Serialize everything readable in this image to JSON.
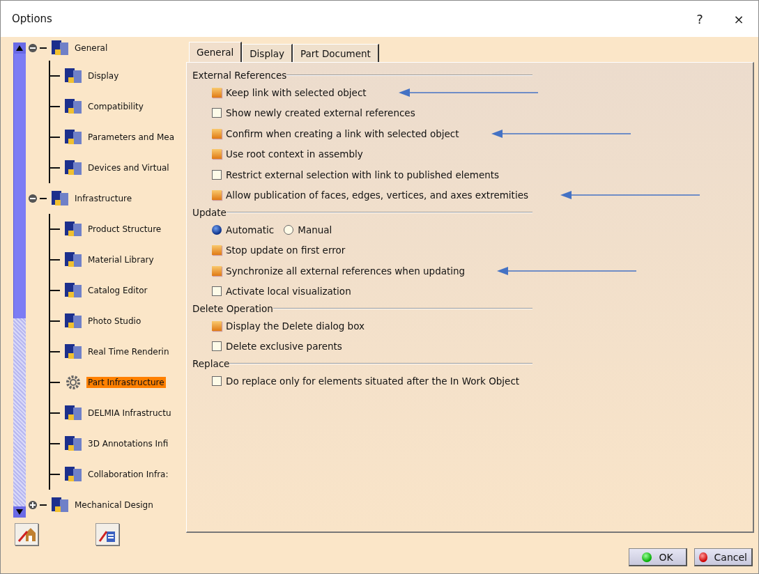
{
  "window": {
    "title": "Options",
    "help": "?",
    "close": "×"
  },
  "tree": [
    {
      "label": "General",
      "expanded": true,
      "selected": false,
      "children": [
        {
          "label": "Display",
          "selected": false
        },
        {
          "label": "Compatibility",
          "selected": false
        },
        {
          "label": "Parameters and Mea",
          "selected": false
        },
        {
          "label": "Devices and Virtual",
          "selected": false
        }
      ]
    },
    {
      "label": "Infrastructure",
      "expanded": true,
      "selected": false,
      "children": [
        {
          "label": "Product Structure",
          "selected": false
        },
        {
          "label": "Material Library",
          "selected": false
        },
        {
          "label": "Catalog Editor",
          "selected": false
        },
        {
          "label": "Photo Studio",
          "selected": false
        },
        {
          "label": "Real Time Renderin",
          "selected": false
        },
        {
          "label": "Part Infrastructure",
          "selected": true
        },
        {
          "label": "DELMIA Infrastructu",
          "selected": false
        },
        {
          "label": "3D Annotations Infi",
          "selected": false
        },
        {
          "label": "Collaboration Infra:",
          "selected": false
        }
      ]
    },
    {
      "label": "Mechanical Design",
      "expanded": false,
      "selected": false
    }
  ],
  "tabs": [
    {
      "label": "General",
      "selected": true
    },
    {
      "label": "Display",
      "selected": false
    },
    {
      "label": "Part Document",
      "selected": false
    }
  ],
  "sections": [
    {
      "title": "External References",
      "items": [
        {
          "kind": "checkbox",
          "label": "Keep link with selected object",
          "checked": true,
          "arrow": true
        },
        {
          "kind": "checkbox",
          "label": "Show newly created external references",
          "checked": false,
          "arrow": false
        },
        {
          "kind": "checkbox",
          "label": "Confirm when creating a link with selected object",
          "checked": true,
          "arrow": true
        },
        {
          "kind": "checkbox",
          "label": "Use root context in assembly",
          "checked": true,
          "arrow": false
        },
        {
          "kind": "checkbox",
          "label": "Restrict external selection with link to published elements",
          "checked": false,
          "arrow": false
        },
        {
          "kind": "checkbox",
          "label": "Allow publication of faces, edges, vertices, and axes extremities",
          "checked": true,
          "arrow": true
        }
      ]
    },
    {
      "title": "Update",
      "items": [
        {
          "kind": "radio",
          "options": [
            {
              "label": "Automatic",
              "selected": true
            },
            {
              "label": "Manual",
              "selected": false
            }
          ]
        },
        {
          "kind": "checkbox",
          "label": "Stop update on first error",
          "checked": true,
          "arrow": false
        },
        {
          "kind": "checkbox",
          "label": "Synchronize all external references when updating",
          "checked": true,
          "arrow": true
        },
        {
          "kind": "checkbox",
          "label": "Activate local visualization",
          "checked": false,
          "arrow": false
        }
      ]
    },
    {
      "title": "Delete Operation",
      "items": [
        {
          "kind": "checkbox",
          "label": "Display the Delete dialog box",
          "checked": true,
          "arrow": false
        },
        {
          "kind": "checkbox",
          "label": "Delete exclusive parents",
          "checked": false,
          "arrow": false
        }
      ]
    },
    {
      "title": "Replace",
      "items": [
        {
          "kind": "checkbox",
          "label": "Do replace only for elements situated after the In Work Object",
          "checked": false,
          "arrow": false
        }
      ]
    }
  ],
  "buttons": [
    {
      "label": "OK",
      "kind": "ok"
    },
    {
      "label": "Cancel",
      "kind": "cancel"
    }
  ]
}
